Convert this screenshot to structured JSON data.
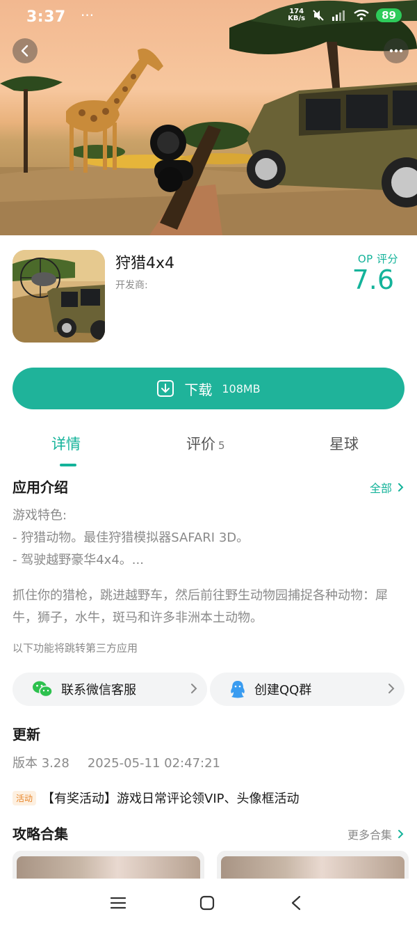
{
  "status_bar": {
    "time": "3:37",
    "dots": "···",
    "net_speed_value": "174",
    "net_speed_unit": "KB/s",
    "battery": "89"
  },
  "app": {
    "name": "狩猎4x4",
    "developer_label": "开发商:",
    "score_label": "OP 评分",
    "score": "7.6"
  },
  "download": {
    "label": "下载",
    "size": "108MB"
  },
  "tabs": [
    {
      "label": "详情",
      "count": ""
    },
    {
      "label": "评价",
      "count": "5"
    },
    {
      "label": "星球",
      "count": ""
    }
  ],
  "intro": {
    "title": "应用介绍",
    "more_label": "全部",
    "features_heading": "游戏特色:",
    "feature_1": "- 狩猎动物。最佳狩猎模拟器SAFARI 3D。",
    "feature_2": "- 驾驶越野豪华4x4。...",
    "description": "抓住你的猎枪，跳进越野车，然后前往野生动物园捕捉各种动物：犀牛，狮子，水牛，斑马和许多非洲本土动物。",
    "third_party_note": "以下功能将跳转第三方应用"
  },
  "services": {
    "wechat_label": "联系微信客服",
    "qq_label": "创建QQ群"
  },
  "update": {
    "title": "更新",
    "version": "版本 3.28",
    "timestamp": "2025-05-11 02:47:21"
  },
  "promo": {
    "tag": "活动",
    "text": "【有奖活动】游戏日常评论领VIP、头像框活动"
  },
  "guides": {
    "title": "攻略合集",
    "more_label": "更多合集"
  },
  "colors": {
    "accent": "#1fb39a",
    "score": "#14b39a",
    "battery": "#2ecb5a",
    "promo_tag": "#e8862a"
  },
  "icons": {
    "back": "chevron-left-icon",
    "more": "more-horizontal-icon",
    "download": "download-icon",
    "wechat": "wechat-icon",
    "qq": "qq-penguin-icon",
    "nav_menu": "menu-icon",
    "nav_home": "home-square-icon",
    "nav_back": "back-triangle-icon"
  }
}
